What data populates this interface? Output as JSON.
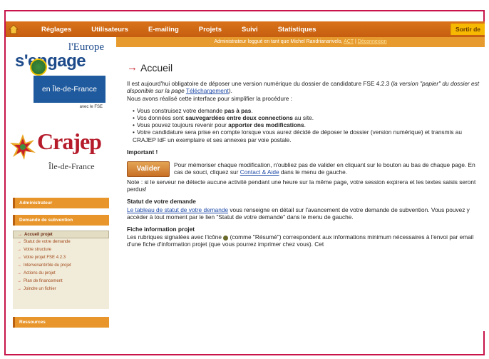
{
  "nav": {
    "items": [
      "Réglages",
      "Utilisateurs",
      "E-mailing",
      "Projets",
      "Suivi",
      "Statistiques"
    ],
    "logout": "Sortir de",
    "admin_text": "Administrateur loggué en tant que Michel Randrianarivelo,",
    "admin_link1": "ACT",
    "admin_sep": " | ",
    "admin_link2": "Déconnexion"
  },
  "logo_europe": {
    "top": "l'Europe",
    "engage": "s'engage",
    "region": "en Île-de-France",
    "fse": "avec le FSE"
  },
  "logo_crajep": {
    "name": "Crajep",
    "sub": "Île-de-France"
  },
  "sidebar": {
    "admin_head": "Administrateur",
    "demande_head": "Demande de subvention",
    "items": [
      "Accueil projet",
      "Statut de votre demande",
      "Votre structure",
      "Votre projet FSE 4.2.3",
      "Intervenant/rôle du projet",
      "Actions du projet",
      "Plan de financement",
      "Joindre un fichier"
    ],
    "ressources_head": "Ressources"
  },
  "content": {
    "title": "Accueil",
    "p1_a": "Il est aujourd'hui obligatoire de déposer une version numérique du dossier de candidature FSE 4.2.3 (",
    "p1_b": "la version \"papier\" du dossier est disponible sur la page",
    "p1_link": "Téléchargement",
    "p1_c": ").",
    "p1_d": "Nous avons réalisé cette interface pour simplifier la procédure :",
    "bullets": [
      {
        "pre": "Vous construisez votre demande ",
        "bold": "pas à pas",
        "post": "."
      },
      {
        "pre": "Vos données sont ",
        "bold": "sauvegardées entre deux connections",
        "post": " au site."
      },
      {
        "pre": "Vous pouvez toujours revenir pour ",
        "bold": "apporter des modifications",
        "post": "."
      },
      {
        "pre": "Votre candidature sera prise en compte lorsque vous aurez décidé de déposer le dossier (version numérique) et transmis au CRAJEP IdF un exemplaire et ses annexes par voie postale.",
        "bold": "",
        "post": ""
      }
    ],
    "important": "Important !",
    "valider": "Valider",
    "valider_text_a": "Pour mémoriser chaque modification, n'oubliez pas de valider en cliquant sur le bouton au bas de chaque page. En cas de souci, cliquez sur",
    "valider_link": "Contact & Aide",
    "valider_text_b": "dans le menu de gauche.",
    "note": "Note : si le serveur ne détecte aucune activité pendant une heure sur la même page, votre session expirera et les textes saisis seront perdus!",
    "statut_title": "Statut de votre demande",
    "statut_link": "Le tableau de statut de votre demande",
    "statut_text": "vous renseigne en détail sur l'avancement de votre demande de subvention. Vous pouvez y accéder à tout moment par le lien \"Statut de votre demande\" dans le menu de gauche.",
    "fiche_title": "Fiche information projet",
    "fiche_text_a": "Les rubriques signalées avec l'icône",
    "fiche_text_b": "(comme \"Résumé\") correspondent aux informations minimum nécessaires à l'envoi par email d'une fiche d'information projet (que vous pourrez imprimer chez vous). Cet"
  },
  "colors": {
    "nav": "#c65e10",
    "frame": "#c8144a",
    "link": "#1f4aa8",
    "europe_blue": "#1f5a9e",
    "crajep_red": "#b51b2a"
  }
}
